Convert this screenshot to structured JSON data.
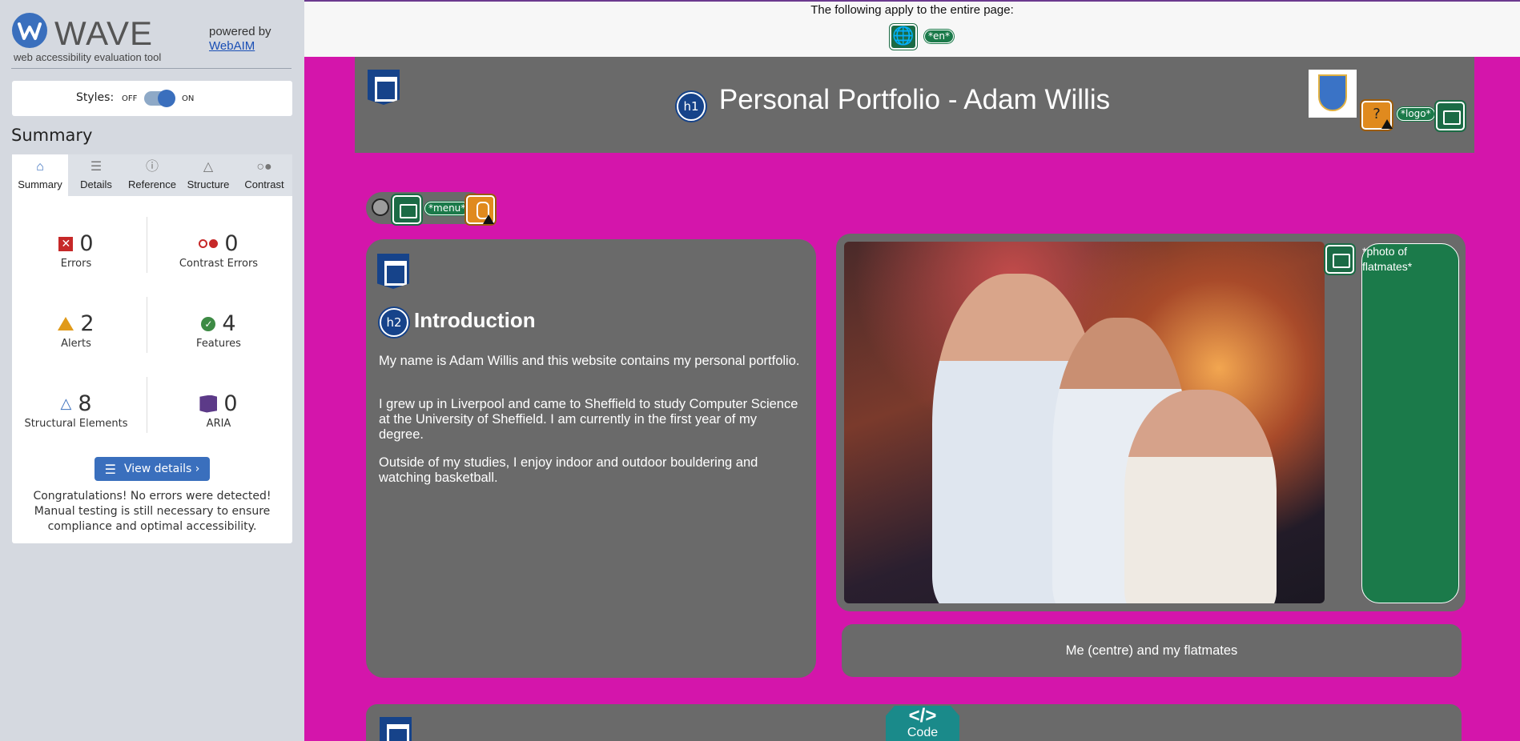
{
  "wave": {
    "title": "WAVE",
    "subtitle": "web accessibility evaluation tool",
    "powered_by": "powered by",
    "webaim_link": "WebAIM",
    "styles_label": "Styles:",
    "styles_off": "OFF",
    "styles_on": "ON",
    "summary_heading": "Summary",
    "tabs": [
      {
        "label": "Summary",
        "icon": "home-icon",
        "active": true
      },
      {
        "label": "Details",
        "icon": "list-icon",
        "active": false
      },
      {
        "label": "Reference",
        "icon": "info-icon",
        "active": false
      },
      {
        "label": "Structure",
        "icon": "hierarchy-icon",
        "active": false
      },
      {
        "label": "Contrast",
        "icon": "contrast-icon",
        "active": false
      }
    ],
    "stats": {
      "errors": {
        "value": "0",
        "label": "Errors"
      },
      "contrast_errors": {
        "value": "0",
        "label": "Contrast Errors"
      },
      "alerts": {
        "value": "2",
        "label": "Alerts"
      },
      "features": {
        "value": "4",
        "label": "Features"
      },
      "structural": {
        "value": "8",
        "label": "Structural Elements"
      },
      "aria": {
        "value": "0",
        "label": "ARIA"
      }
    },
    "view_details_button": "View details ›",
    "congrats_message": "Congratulations! No errors were detected! Manual testing is still necessary to ensure compliance and optimal accessibility."
  },
  "page": {
    "top_notice": "The following apply to the entire page:",
    "lang_pill": "*en*",
    "h1_badge": "h1",
    "h1_text": "Personal Portfolio - Adam Willis",
    "logo_question": "?",
    "logo_pill": "*logo*",
    "menu_pill": "*menu*",
    "h2_badge": "h2",
    "h2_text": "Introduction",
    "intro_paragraphs": [
      "My name is Adam Willis and this website contains my personal portfolio.",
      "I grew up in Liverpool and came to Sheffield to study Computer Science at the University of Sheffield. I am currently in the first year of my degree.",
      "Outside of my studies, I enjoy indoor and outdoor bouldering and watching basketball."
    ],
    "photo_alt_line1": "*photo of",
    "photo_alt_line2": "flatmates*",
    "caption": "Me (centre) and my flatmates",
    "code_symbol": "</>",
    "code_label": "Code"
  },
  "colors": {
    "page_background": "#d415ab",
    "panel_grey": "#6a6a6a",
    "wave_blue": "#3a6fbd",
    "feature_green": "#1b7a4a",
    "heading_badge_blue": "#16438a"
  }
}
